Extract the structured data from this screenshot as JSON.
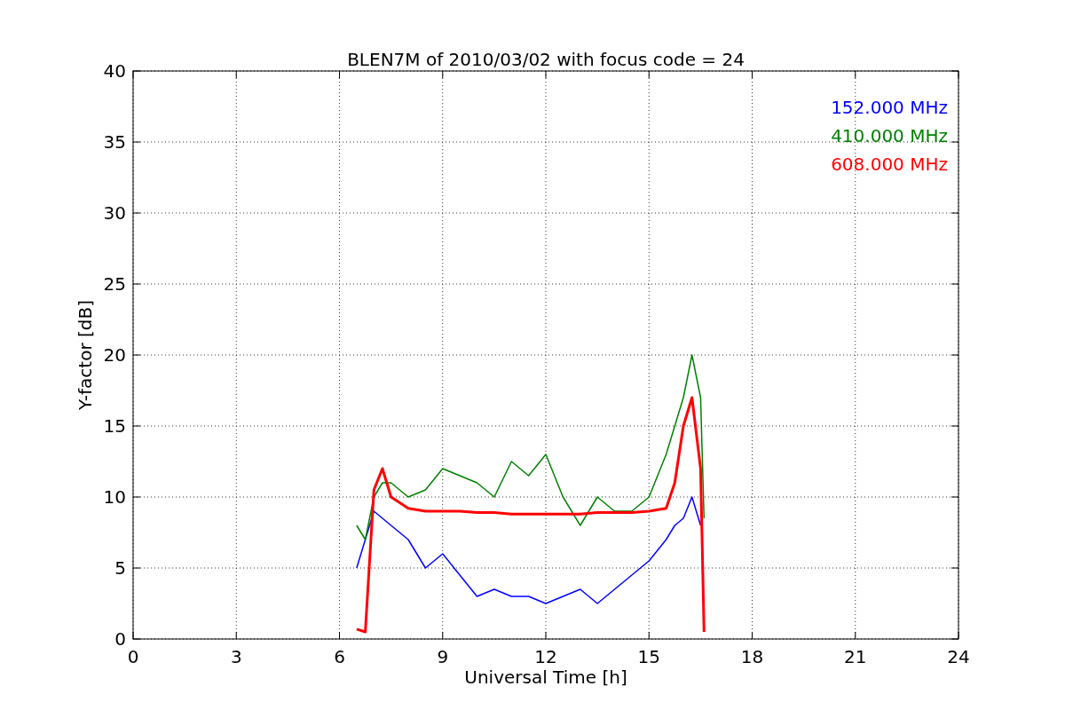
{
  "chart_data": {
    "type": "line",
    "title": "BLEN7M of 2010/03/02 with focus code = 24",
    "xlabel": "Universal Time [h]",
    "ylabel": "Y-factor [dB]",
    "x": [
      6.5,
      6.75,
      7,
      7.25,
      7.5,
      8,
      8.5,
      9,
      9.5,
      10,
      10.5,
      11,
      11.5,
      12,
      12.5,
      13,
      13.5,
      14,
      14.5,
      15,
      15.5,
      15.75,
      16,
      16.25,
      16.5,
      16.6
    ],
    "series": [
      {
        "name": "152.000 MHz",
        "color": "#0000ff",
        "values": [
          5,
          7,
          9,
          8.5,
          8,
          7,
          5,
          6,
          4.5,
          3,
          3.5,
          3,
          3,
          2.5,
          3,
          3.5,
          2.5,
          3.5,
          4.5,
          5.5,
          7,
          8,
          8.5,
          10,
          8,
          null
        ]
      },
      {
        "name": "410.000 MHz",
        "color": "#008000",
        "values": [
          8,
          7,
          10,
          11,
          11,
          10,
          10.5,
          12,
          11.5,
          11,
          10,
          12.5,
          11.5,
          13,
          10,
          8,
          10,
          9,
          9,
          10,
          13,
          15,
          17,
          20,
          17,
          8.5
        ]
      },
      {
        "name": "608.000 MHz",
        "color": "#ff0000",
        "values": [
          0.7,
          0.5,
          10.5,
          12,
          10,
          9.2,
          9,
          9,
          9,
          8.9,
          8.9,
          8.8,
          8.8,
          8.8,
          8.8,
          8.8,
          8.9,
          8.9,
          8.9,
          9,
          9.2,
          11,
          15,
          17,
          12,
          0.5
        ]
      }
    ],
    "xlim": [
      0,
      24
    ],
    "ylim": [
      0,
      40
    ],
    "xticks": [
      0,
      3,
      6,
      9,
      12,
      15,
      18,
      21,
      24
    ],
    "yticks": [
      0,
      5,
      10,
      15,
      20,
      25,
      30,
      35,
      40
    ],
    "grid": true
  }
}
